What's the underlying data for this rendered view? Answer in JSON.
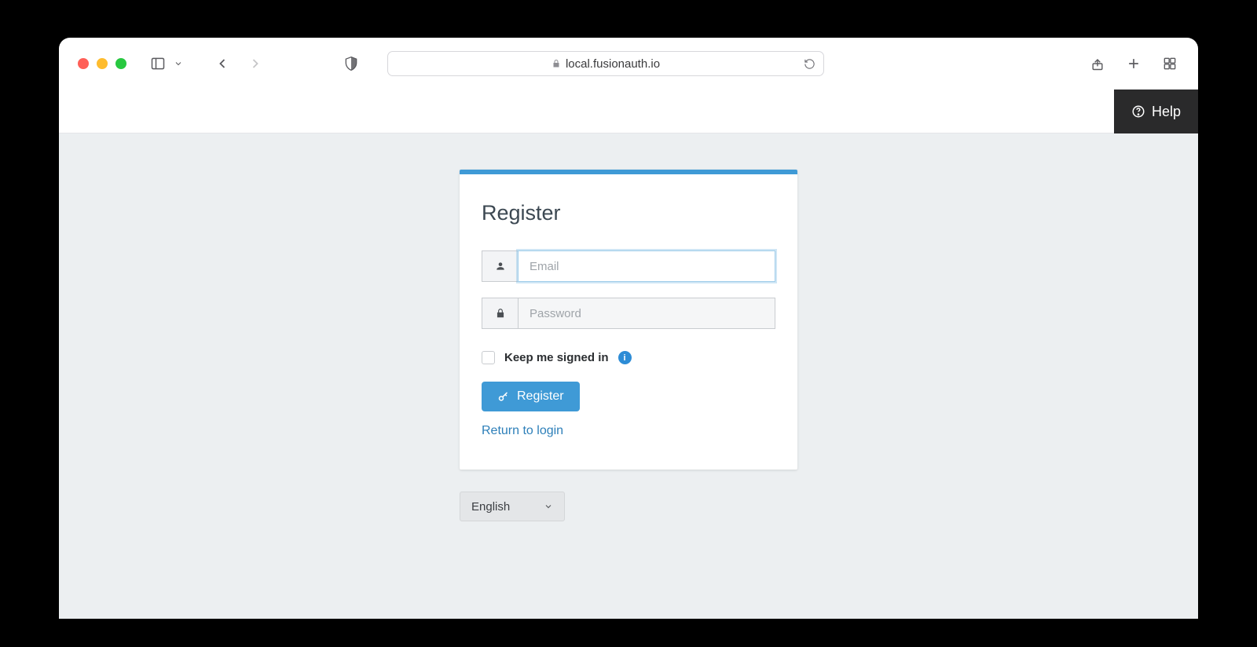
{
  "browser": {
    "url": "local.fusionauth.io"
  },
  "header": {
    "help_label": "Help"
  },
  "card": {
    "title": "Register",
    "email_placeholder": "Email",
    "password_placeholder": "Password",
    "keep_signed_in_label": "Keep me signed in",
    "register_button": "Register",
    "return_link": "Return to login"
  },
  "language": {
    "selected": "English"
  }
}
